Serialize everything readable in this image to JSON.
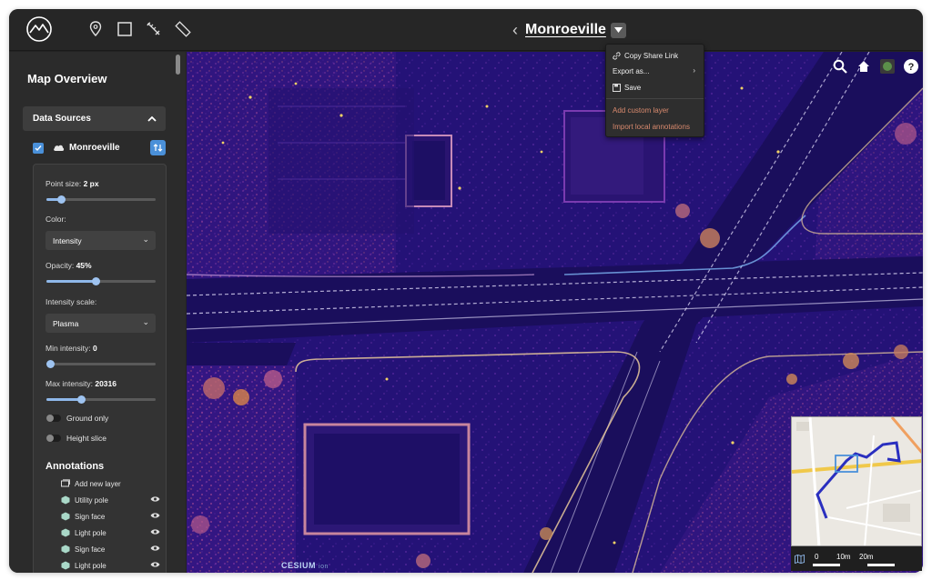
{
  "header": {
    "title": "Monroeville",
    "tools": [
      "map-pin-icon",
      "square-select-icon",
      "measure-pen-icon",
      "ruler-icon"
    ]
  },
  "sidebar": {
    "title": "Map Overview",
    "data_sources_label": "Data Sources",
    "source": {
      "name": "Monroeville",
      "checked": true
    },
    "panel": {
      "point_size_label": "Point size:",
      "point_size_value": "2 px",
      "point_size_fraction": 0.14,
      "color_label": "Color:",
      "color_value": "Intensity",
      "opacity_label": "Opacity:",
      "opacity_value": "45%",
      "opacity_fraction": 0.45,
      "intensity_scale_label": "Intensity scale:",
      "intensity_scale_value": "Plasma",
      "min_intensity_label": "Min intensity:",
      "min_intensity_value": "0",
      "min_intensity_fraction": 0.0,
      "max_intensity_label": "Max intensity:",
      "max_intensity_value": "20316",
      "max_intensity_fraction": 0.31,
      "ground_only_label": "Ground only",
      "ground_only_on": false,
      "height_slice_label": "Height slice",
      "height_slice_on": false
    },
    "annotations": {
      "title": "Annotations",
      "add_label": "Add new layer",
      "items": [
        {
          "label": "Utility pole"
        },
        {
          "label": "Sign face"
        },
        {
          "label": "Light pole"
        },
        {
          "label": "Sign face"
        },
        {
          "label": "Light pole"
        }
      ]
    }
  },
  "menu": {
    "items": [
      {
        "label": "Copy Share Link",
        "icon": "link-icon"
      },
      {
        "label": "Export as...",
        "icon": "",
        "submenu": true
      },
      {
        "label": "Save",
        "icon": "save-icon"
      },
      {
        "label": "Add custom layer",
        "icon": ""
      },
      {
        "label": "Import local annotations",
        "icon": ""
      }
    ]
  },
  "map": {
    "icons": [
      "search-icon",
      "home-icon",
      "layers-icon",
      "help-icon"
    ],
    "attribution": "CESIUM",
    "attribution_small": "ion",
    "minimap": {
      "scale_labels": [
        "0",
        "10m",
        "20m"
      ]
    }
  },
  "colors": {
    "accent": "#4a90d9",
    "warn": "#d98a6e",
    "map_base": "#1c0f6b",
    "road_marking": "#e9e4ff"
  }
}
